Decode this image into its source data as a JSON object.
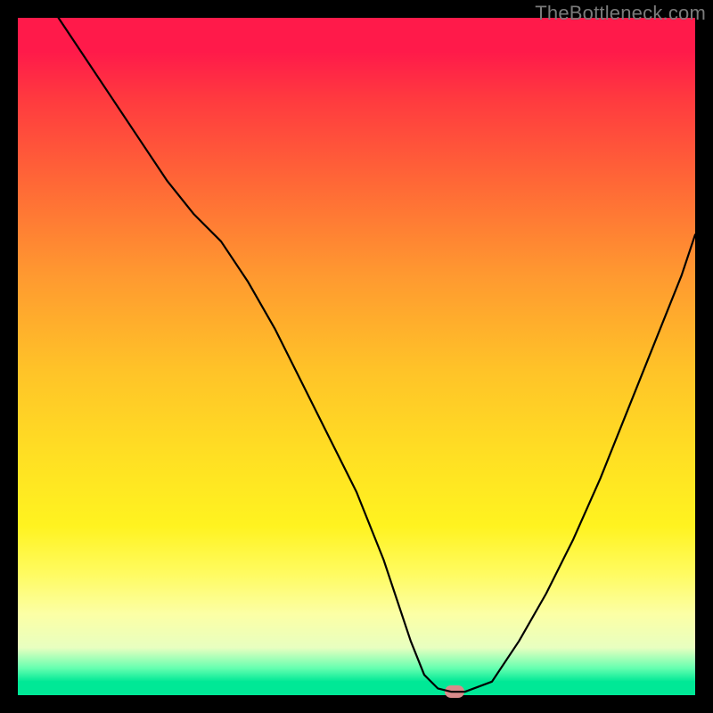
{
  "watermark": "TheBottleneck.com",
  "chart_data": {
    "type": "line",
    "title": "",
    "xlabel": "",
    "ylabel": "",
    "xlim": [
      0,
      100
    ],
    "ylim": [
      0,
      100
    ],
    "x": [
      6,
      10,
      14,
      18,
      22,
      26,
      30,
      34,
      38,
      42,
      46,
      50,
      54,
      56,
      58,
      60,
      62,
      64,
      66,
      70,
      74,
      78,
      82,
      86,
      90,
      94,
      98,
      100
    ],
    "y": [
      100,
      94,
      88,
      82,
      76,
      71,
      67,
      61,
      54,
      46,
      38,
      30,
      20,
      14,
      8,
      3,
      1,
      0.5,
      0.5,
      2,
      8,
      15,
      23,
      32,
      42,
      52,
      62,
      68
    ],
    "marker": {
      "x": 64.5,
      "y": 0.5
    },
    "gradient_stops": [
      {
        "pos": 0,
        "color": "#ff1a4a"
      },
      {
        "pos": 25,
        "color": "#ff6a36"
      },
      {
        "pos": 52,
        "color": "#ffc328"
      },
      {
        "pos": 75,
        "color": "#fff320"
      },
      {
        "pos": 96,
        "color": "#66ffb0"
      },
      {
        "pos": 100,
        "color": "#00e896"
      }
    ]
  }
}
